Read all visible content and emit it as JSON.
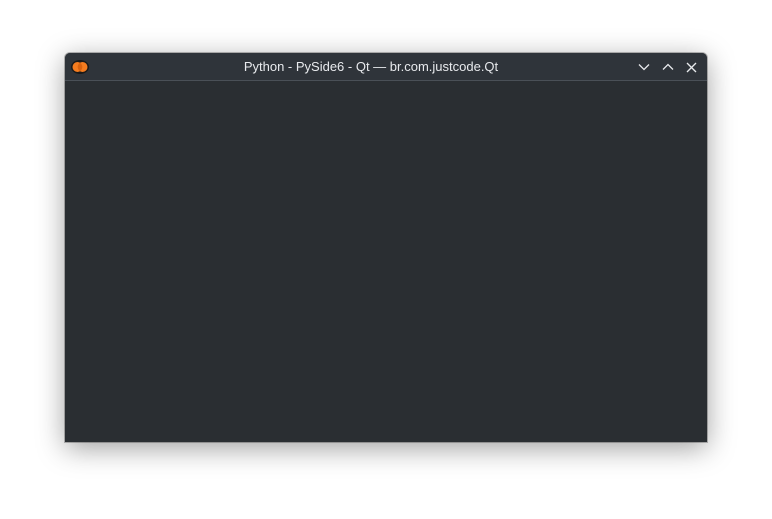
{
  "window": {
    "title": "Python - PySide6 - Qt — br.com.justcode.Qt",
    "app_icon": "python-qt-icon",
    "controls": {
      "minimize_icon": "chevron-down-icon",
      "maximize_icon": "chevron-up-icon",
      "close_icon": "close-icon"
    }
  },
  "colors": {
    "titlebar_bg": "#2f343a",
    "client_bg": "#2a2e32",
    "title_text": "#e8eaed",
    "icon_orange": "#f57c1f"
  }
}
